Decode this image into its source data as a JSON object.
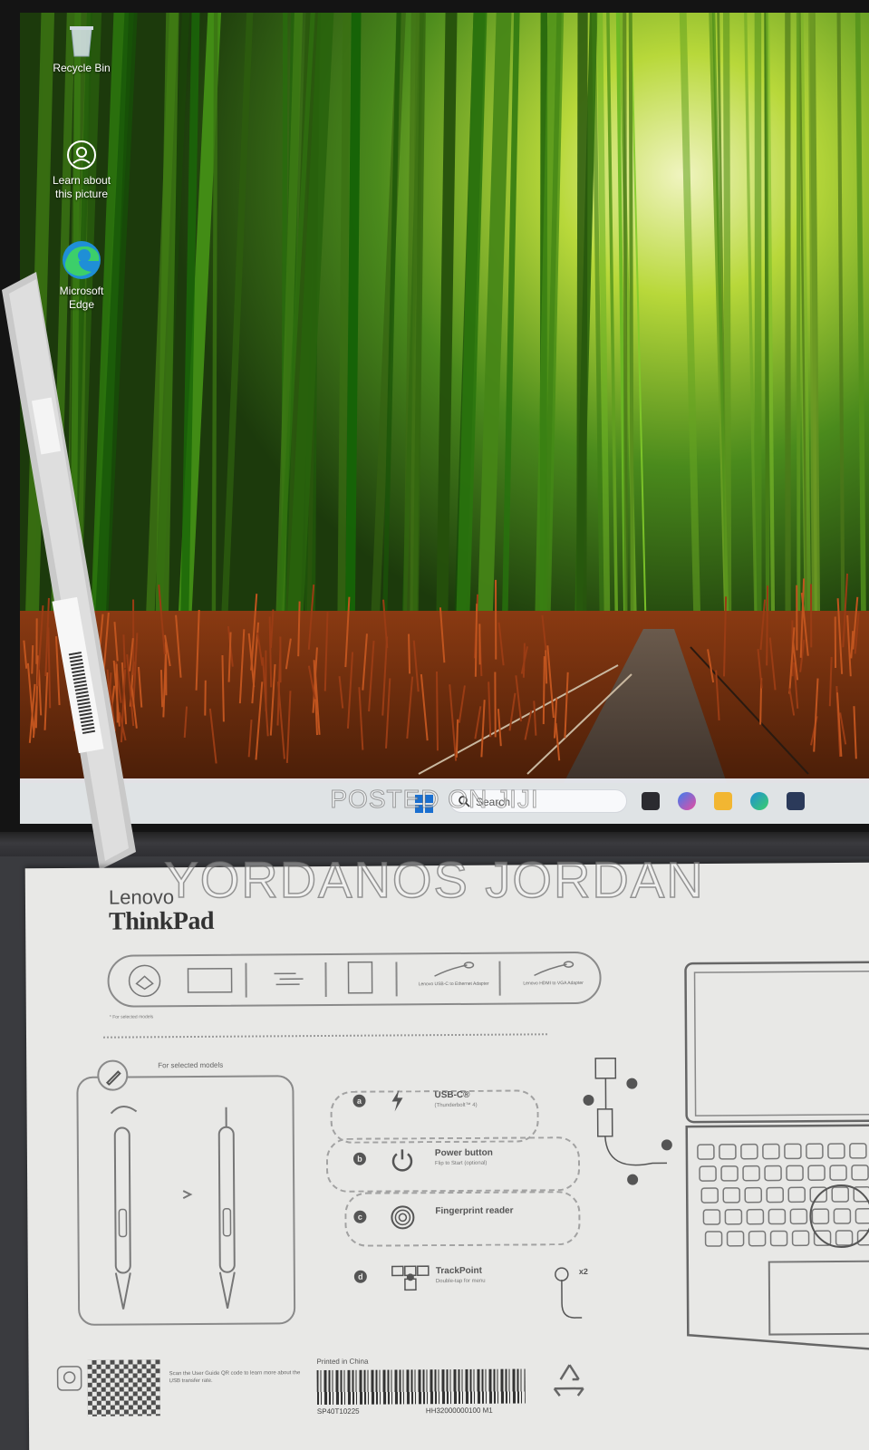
{
  "desktop": {
    "icons": [
      {
        "label": "Recycle Bin",
        "icon": "recycle-bin-icon"
      },
      {
        "label": "Learn about this picture",
        "icon": "camera-icon"
      },
      {
        "label": "Microsoft Edge",
        "icon": "edge-icon"
      }
    ]
  },
  "taskbar": {
    "search_placeholder": "Search",
    "start_icon": "windows-start-icon",
    "apps": [
      "task-view-icon",
      "copilot-icon",
      "file-explorer-icon",
      "edge-icon",
      "store-icon"
    ]
  },
  "watermarks": {
    "posted": "POSTED ON JIJI",
    "seller": "YORDANOS JORDAN"
  },
  "paper": {
    "brand_top": "Lenovo",
    "brand_bottom": "ThinkPad",
    "selected_models": "For selected models",
    "features": [
      {
        "letter": "a",
        "title": "USB-C®",
        "sub": "(Thunderbolt™ 4)",
        "icon": "thunderbolt-icon"
      },
      {
        "letter": "b",
        "title": "Power button",
        "sub": "Flip to Start (optional)",
        "icon": "power-icon"
      },
      {
        "letter": "c",
        "title": "Fingerprint reader",
        "sub": "",
        "icon": "fingerprint-icon"
      },
      {
        "letter": "d",
        "title": "TrackPoint",
        "sub": "Double-tap for menu",
        "icon": "trackpoint-icon"
      }
    ],
    "tap_count": "x2",
    "printed_in": "Printed in China",
    "part_number": "SP40T10225",
    "part_number_2": "HH32000000100 M1",
    "accessory_labels": [
      "Lenovo USB-C to Ethernet Adapter",
      "Lenovo HDMI to VGA Adapter"
    ],
    "accessory_note": "* For selected models",
    "usb_note": "Scan the User Guide QR code to learn more about the USB transfer rate."
  },
  "colors": {
    "taskbar": "#eef0f6",
    "paper": "#e8e8e6",
    "bezel": "#141414"
  }
}
